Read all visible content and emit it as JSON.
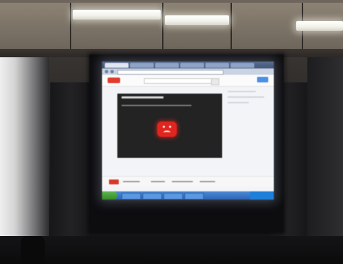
{
  "scene": {
    "subject": "",
    "colors": {
      "youtube_red": "#e0251f",
      "taskbar_blue": "#2d62b4",
      "start_green": "#368a2b",
      "screen_white": "#f3f4f7",
      "player_dark": "#232323"
    },
    "icons": [
      "youtube-logo-icon",
      "error-face-icon",
      "start-button-icon"
    ]
  }
}
